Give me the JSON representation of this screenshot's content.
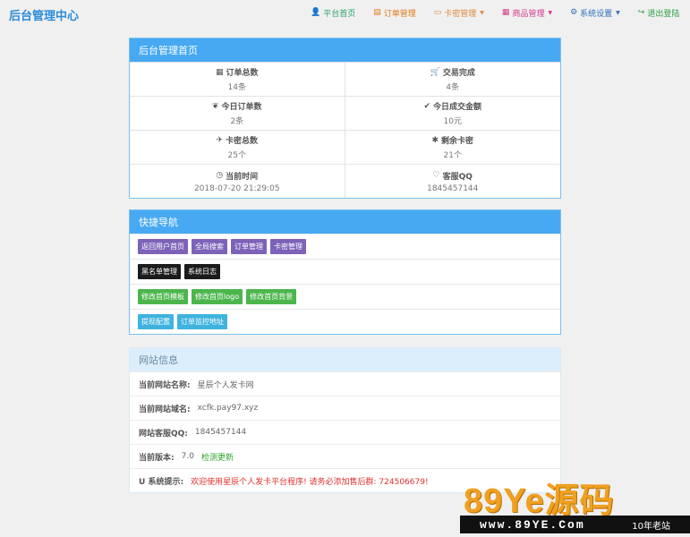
{
  "brand": "后台管理中心",
  "nav": [
    {
      "label": "平台首页",
      "icon": "user-icon",
      "color": "#2aa06a",
      "dropdown": false
    },
    {
      "label": "订单管理",
      "icon": "list-icon",
      "color": "#e07a1a",
      "dropdown": false
    },
    {
      "label": "卡密管理",
      "icon": "card-icon",
      "color": "#e0883a",
      "dropdown": true
    },
    {
      "label": "商品管理",
      "icon": "grid-icon",
      "color": "#d43a8a",
      "dropdown": true
    },
    {
      "label": "系统设置",
      "icon": "gear-icon",
      "color": "#2a6db5",
      "dropdown": true
    },
    {
      "label": "退出登陆",
      "icon": "logout-icon",
      "color": "#2aa040",
      "dropdown": false
    }
  ],
  "dashboard": {
    "title": "后台管理首页",
    "stats": [
      {
        "label": "订单总数",
        "value": "14条",
        "icon": "grid-icon"
      },
      {
        "label": "交易完成",
        "value": "4条",
        "icon": "cart-icon"
      },
      {
        "label": "今日订单数",
        "value": "2条",
        "icon": "leaf-icon"
      },
      {
        "label": "今日成交金额",
        "value": "10元",
        "icon": "check-icon"
      },
      {
        "label": "卡密总数",
        "value": "25个",
        "icon": "plane-icon"
      },
      {
        "label": "剩余卡密",
        "value": "21个",
        "icon": "asterisk-icon"
      },
      {
        "label": "当前时间",
        "value": "2018-07-20 21:29:05",
        "icon": "clock-icon"
      },
      {
        "label": "客服QQ",
        "value": "1845457144",
        "icon": "heart-icon"
      }
    ]
  },
  "quicknav": {
    "title": "快捷导航",
    "rows": [
      {
        "style": "purple",
        "items": [
          "返回用户首页",
          "全局搜索",
          "订单管理",
          "卡密管理"
        ]
      },
      {
        "style": "black",
        "items": [
          "黑名单管理",
          "系统日志"
        ]
      },
      {
        "style": "green",
        "items": [
          "修改首页模板",
          "修改首页logo",
          "修改首页背景"
        ]
      },
      {
        "style": "blue",
        "items": [
          "提现配置",
          "订单监控地址"
        ]
      }
    ]
  },
  "siteinfo": {
    "title": "网站信息",
    "name_label": "当前网站名称:",
    "name_value": "星辰个人发卡网",
    "domain_label": "当前网站域名:",
    "domain_value": "xcfk.pay97.xyz",
    "qq_label": "网站客服QQ:",
    "qq_value": "1845457144",
    "version_label": "当前版本:",
    "version_value": "7.0",
    "update_link": "检测更新",
    "notice_label": "系统提示:",
    "notice_text": "欢迎使用星辰个人发卡平台程序! 请务必添加售后群: 724506679!"
  },
  "watermark": {
    "big": "89Ye源码",
    "url": "www.89YE.Com",
    "tag": "10年老站"
  }
}
